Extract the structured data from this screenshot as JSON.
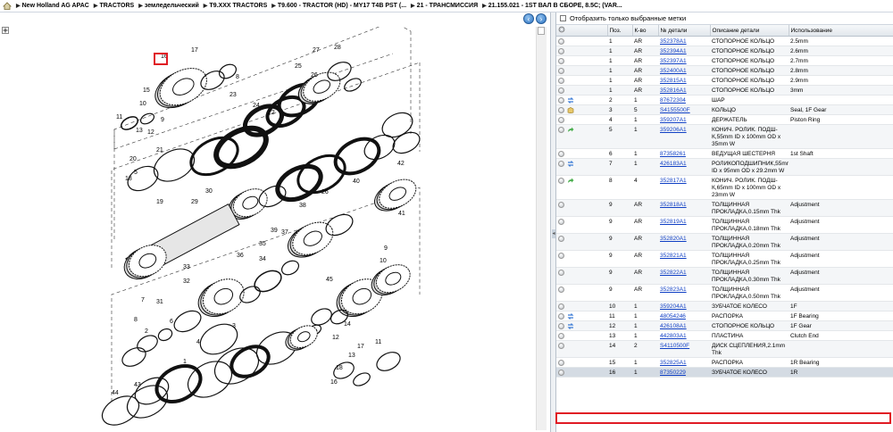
{
  "breadcrumb": [
    "New Holland AG APAC",
    "TRACTORS",
    "земледельческий",
    "T9.XXX TRACTORS",
    "T9.600 - TRACTOR (HD) - MY17 T4B PST (...",
    "21 - ТРАНСМИССИЯ",
    "21.155.021 - 1ST ВАЛ В СБОРЕ, 8.5C; (VAR..."
  ],
  "icons": {
    "home": "home-icon",
    "back": "back-arrow-icon",
    "forward": "forward-arrow-icon",
    "expand": "expand-icon",
    "settings": "gear-icon"
  },
  "colors": {
    "highlight_border": "#e01b24",
    "link": "#0f3fc4",
    "row_alt": "#f4f6f8",
    "nav": "#2f75c4"
  },
  "filter": {
    "label": "Отобразить только выбранные метки",
    "checked": false
  },
  "table": {
    "headers": [
      "",
      "Поз.",
      "К-во",
      "№ детали",
      "Описание детали",
      "Использование"
    ],
    "rows": [
      {
        "pos": "1",
        "qty": "AR",
        "part": "352378A1",
        "desc": "СТОПОРНОЕ КОЛЬЦО",
        "use": "2.5mm",
        "icon": ""
      },
      {
        "pos": "1",
        "qty": "AR",
        "part": "352394A1",
        "desc": "СТОПОРНОЕ КОЛЬЦО",
        "use": "2.6mm",
        "icon": ""
      },
      {
        "pos": "1",
        "qty": "AR",
        "part": "352397A1",
        "desc": "СТОПОРНОЕ КОЛЬЦО",
        "use": "2.7mm",
        "icon": ""
      },
      {
        "pos": "1",
        "qty": "AR",
        "part": "352400A1",
        "desc": "СТОПОРНОЕ КОЛЬЦО",
        "use": "2.8mm",
        "icon": ""
      },
      {
        "pos": "1",
        "qty": "AR",
        "part": "352815A1",
        "desc": "СТОПОРНОЕ КОЛЬЦО",
        "use": "2.9mm",
        "icon": ""
      },
      {
        "pos": "1",
        "qty": "AR",
        "part": "352816A1",
        "desc": "СТОПОРНОЕ КОЛЬЦО",
        "use": "3mm",
        "icon": ""
      },
      {
        "pos": "2",
        "qty": "1",
        "part": "87672304",
        "desc": "ШАР",
        "use": "",
        "icon": "swap"
      },
      {
        "pos": "3",
        "qty": "5",
        "part": "S4155500F",
        "desc": "КОЛЬЦО",
        "use": "Seal, 1F Gear",
        "icon": "box"
      },
      {
        "pos": "4",
        "qty": "1",
        "part": "359207A1",
        "desc": "ДЕРЖАТЕЛЬ",
        "use": "Piston Ring",
        "icon": ""
      },
      {
        "pos": "5",
        "qty": "1",
        "part": "359206A1",
        "desc": "КОНИЧ. РОЛИК. ПОДШ-К,55mm ID x 100mm OD x 35mm W",
        "use": "",
        "icon": "arrow"
      },
      {
        "pos": "6",
        "qty": "1",
        "part": "87358261",
        "desc": "ВЕДУЩАЯ ШЕСТЕРНЯ",
        "use": "1st Shaft",
        "icon": ""
      },
      {
        "pos": "7",
        "qty": "1",
        "part": "426183A1",
        "desc": "РОЛИКОПОДШИПНИК,55mm ID x 95mm OD x 29.2mm W",
        "use": "",
        "icon": "swap"
      },
      {
        "pos": "8",
        "qty": "4",
        "part": "352817A1",
        "desc": "КОНИЧ. РОЛИК. ПОДШ-К,65mm ID x 100mm OD x 23mm W",
        "use": "",
        "icon": "arrow"
      },
      {
        "pos": "9",
        "qty": "AR",
        "part": "352818A1",
        "desc": "ТОЛЩИННАЯ ПРОКЛАДКА,0.15mm Thk",
        "use": "Adjustment",
        "icon": ""
      },
      {
        "pos": "9",
        "qty": "AR",
        "part": "352819A1",
        "desc": "ТОЛЩИННАЯ ПРОКЛАДКА,0.18mm Thk",
        "use": "Adjustment",
        "icon": ""
      },
      {
        "pos": "9",
        "qty": "AR",
        "part": "352820A1",
        "desc": "ТОЛЩИННАЯ ПРОКЛАДКА,0.20mm Thk",
        "use": "Adjustment",
        "icon": ""
      },
      {
        "pos": "9",
        "qty": "AR",
        "part": "352821A1",
        "desc": "ТОЛЩИННАЯ ПРОКЛАДКА,0.25mm Thk",
        "use": "Adjustment",
        "icon": ""
      },
      {
        "pos": "9",
        "qty": "AR",
        "part": "352822A1",
        "desc": "ТОЛЩИННАЯ ПРОКЛАДКА,0.30mm Thk",
        "use": "Adjustment",
        "icon": ""
      },
      {
        "pos": "9",
        "qty": "AR",
        "part": "352823A1",
        "desc": "ТОЛЩИННАЯ ПРОКЛАДКА,0.50mm Thk",
        "use": "Adjustment",
        "icon": ""
      },
      {
        "pos": "10",
        "qty": "1",
        "part": "359204A1",
        "desc": "ЗУБЧАТОЕ КОЛЕСО",
        "use": "1F",
        "icon": ""
      },
      {
        "pos": "11",
        "qty": "1",
        "part": "48054246",
        "desc": "РАСПОРКА",
        "use": "1F Bearing",
        "icon": "swap"
      },
      {
        "pos": "12",
        "qty": "1",
        "part": "426108A1",
        "desc": "СТОПОРНОЕ КОЛЬЦО",
        "use": "1F Gear",
        "icon": "swap"
      },
      {
        "pos": "13",
        "qty": "1",
        "part": "442803A1",
        "desc": "ПЛАСТИНА",
        "use": "Clutch End",
        "icon": ""
      },
      {
        "pos": "14",
        "qty": "2",
        "part": "S4110500F",
        "desc": "ДИСК СЦЕПЛЕНИЯ,2.1mm Thk",
        "use": "",
        "icon": ""
      },
      {
        "pos": "15",
        "qty": "1",
        "part": "352825A1",
        "desc": "РАСПОРКА",
        "use": "1R Bearing",
        "icon": ""
      },
      {
        "pos": "16",
        "qty": "1",
        "part": "87350229",
        "desc": "ЗУБЧАТОЕ КОЛЕСО",
        "use": "1R",
        "icon": "",
        "selected": true
      }
    ]
  },
  "diagram": {
    "highlighted_callout": "16",
    "callouts": [
      "16",
      "17",
      "8",
      "15",
      "10",
      "11",
      "9",
      "12",
      "13",
      "27",
      "28",
      "25",
      "26",
      "23",
      "24",
      "22",
      "5",
      "21",
      "20",
      "18",
      "19",
      "29",
      "30",
      "26",
      "40",
      "42",
      "41",
      "38",
      "39",
      "37",
      "35",
      "36",
      "34",
      "33",
      "32",
      "31",
      "7",
      "6",
      "8",
      "2",
      "3",
      "4",
      "1",
      "43",
      "44",
      "45",
      "14",
      "12",
      "13",
      "11",
      "9",
      "10",
      "17",
      "18",
      "16",
      "15",
      "14"
    ]
  }
}
